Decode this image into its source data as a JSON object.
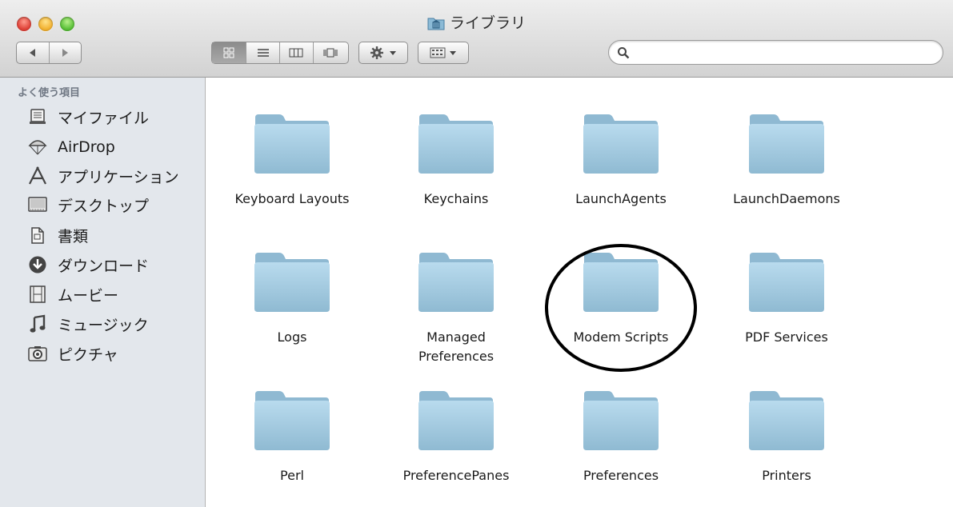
{
  "window": {
    "title": "ライブラリ"
  },
  "toolbar": {
    "nav": {
      "back": "back",
      "forward": "forward"
    },
    "view_modes": [
      "icon",
      "list",
      "column",
      "cover-flow"
    ],
    "action_menu": "gear",
    "arrange_menu": "arrange",
    "search": {
      "placeholder": "",
      "value": ""
    }
  },
  "sidebar": {
    "section": "よく使う項目",
    "items": [
      {
        "label": "マイファイル",
        "icon": "all-my-files-icon"
      },
      {
        "label": "AirDrop",
        "icon": "airdrop-icon"
      },
      {
        "label": "アプリケーション",
        "icon": "applications-icon"
      },
      {
        "label": "デスクトップ",
        "icon": "desktop-icon"
      },
      {
        "label": "書類",
        "icon": "documents-icon"
      },
      {
        "label": "ダウンロード",
        "icon": "downloads-icon"
      },
      {
        "label": "ムービー",
        "icon": "movies-icon"
      },
      {
        "label": "ミュージック",
        "icon": "music-icon"
      },
      {
        "label": "ピクチャ",
        "icon": "pictures-icon"
      }
    ]
  },
  "folders": [
    "Keyboard Layouts",
    "Keychains",
    "LaunchAgents",
    "LaunchDaemons",
    "Logs",
    "Managed\nPreferences",
    "Modem Scripts",
    "PDF Services",
    "Perl",
    "PreferencePanes",
    "Preferences",
    "Printers"
  ],
  "annotation": {
    "circled_item": "Modem Scripts",
    "color": "#000000"
  },
  "colors": {
    "folder": "#a9cde2",
    "sidebar": "#e3e7ec"
  }
}
